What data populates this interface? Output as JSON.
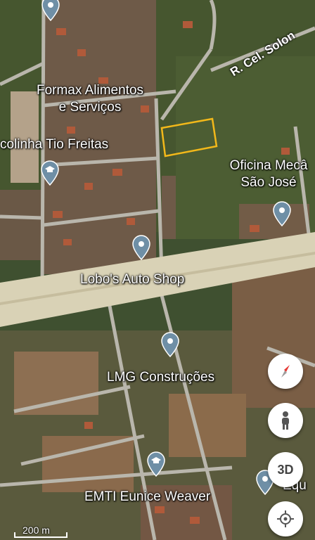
{
  "map": {
    "places": [
      {
        "label_1": "Formax Alimentos",
        "label_2": "e Serviços"
      },
      {
        "label": "colinha Tio Freitas"
      },
      {
        "label_1": "Oficina Mecâ",
        "label_2": "São José"
      },
      {
        "label": "Lobo's Auto Shop"
      },
      {
        "label": "LMG Construções"
      },
      {
        "label": "EMTI Eunice Weaver"
      },
      {
        "label": "Equ"
      }
    ],
    "road_label": "R. Cel. Solon",
    "scale": {
      "label": "200 m"
    },
    "controls": {
      "three_d_label": "3D"
    },
    "colors": {
      "highlight": "#f2b81a",
      "pin": "#6f8fa6",
      "compass_red": "#e53935"
    }
  }
}
